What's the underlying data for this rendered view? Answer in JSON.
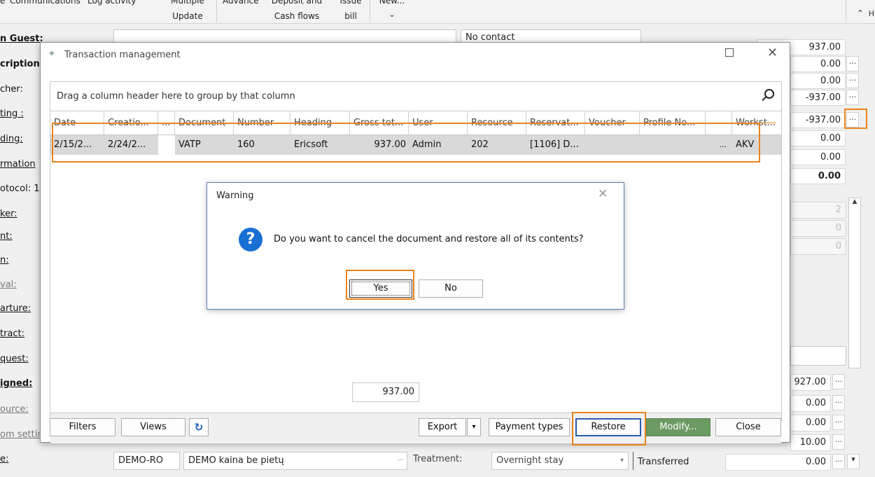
{
  "ribbon": {
    "items": [
      {
        "line1": "e",
        "line2": ""
      },
      {
        "line1": "Communications",
        "line2": ""
      },
      {
        "line1": "Log activity",
        "line2": ""
      },
      {
        "line1": "Multiple",
        "line2": "Update"
      },
      {
        "line1": "Advance",
        "line2": ""
      },
      {
        "line1": "Deposit and",
        "line2": "Cash flows"
      },
      {
        "line1": "Issue",
        "line2": "bill"
      },
      {
        "line1": "New...",
        "line2": "⌄"
      }
    ]
  },
  "left_labels": [
    "n Guest:",
    "cription:",
    "cher:",
    "ting :",
    "ding:",
    "rmation",
    "otocol: 1",
    "ker:",
    "nt:",
    "n:",
    "val:",
    "arture:",
    "tract:",
    "quest:",
    "igned:",
    "ource:",
    "om settin",
    "e:"
  ],
  "background": {
    "contact_value": "No contact",
    "right_values": [
      "937.00",
      "0.00",
      "0.00",
      "-937.00",
      "0.00",
      "0.00",
      "0.00"
    ],
    "right_small": [
      "2",
      "0",
      "0"
    ],
    "lower_values": [
      "927.00",
      "0.00",
      "0.00",
      "10.00",
      "0.00"
    ],
    "bottom_row": {
      "price_code": "DEMO-RO",
      "price_name": "DEMO kaina be pietų",
      "treatment_label": "Treatment:",
      "treatment_value": "Overnight stay",
      "transferred": "Transferred"
    }
  },
  "dialog": {
    "title": "Transaction management",
    "group_hint": "Drag a column header here to group by that column",
    "columns": [
      "Date",
      "Creatio...",
      "...",
      "Document",
      "Number",
      "Heading",
      "Gross tot...",
      "User",
      "Resource",
      "Reservat...",
      "Voucher",
      "Profile No...",
      "",
      "Workst..."
    ],
    "row": [
      "2/15/2...",
      "2/24/2...",
      "",
      "VATP",
      "160",
      "Ericsoft",
      "937.00",
      "Admin",
      "202",
      "[1106] D...",
      "",
      "",
      "...",
      "AKV"
    ],
    "total": "937.00",
    "buttons": {
      "filters": "Filters",
      "views": "Views",
      "export": "Export",
      "payment_types": "Payment types",
      "restore": "Restore",
      "modify": "Modify...",
      "close": "Close"
    }
  },
  "warning": {
    "title": "Warning",
    "message": "Do you want to cancel the document and restore all of its contents?",
    "yes": "Yes",
    "no": "No"
  }
}
